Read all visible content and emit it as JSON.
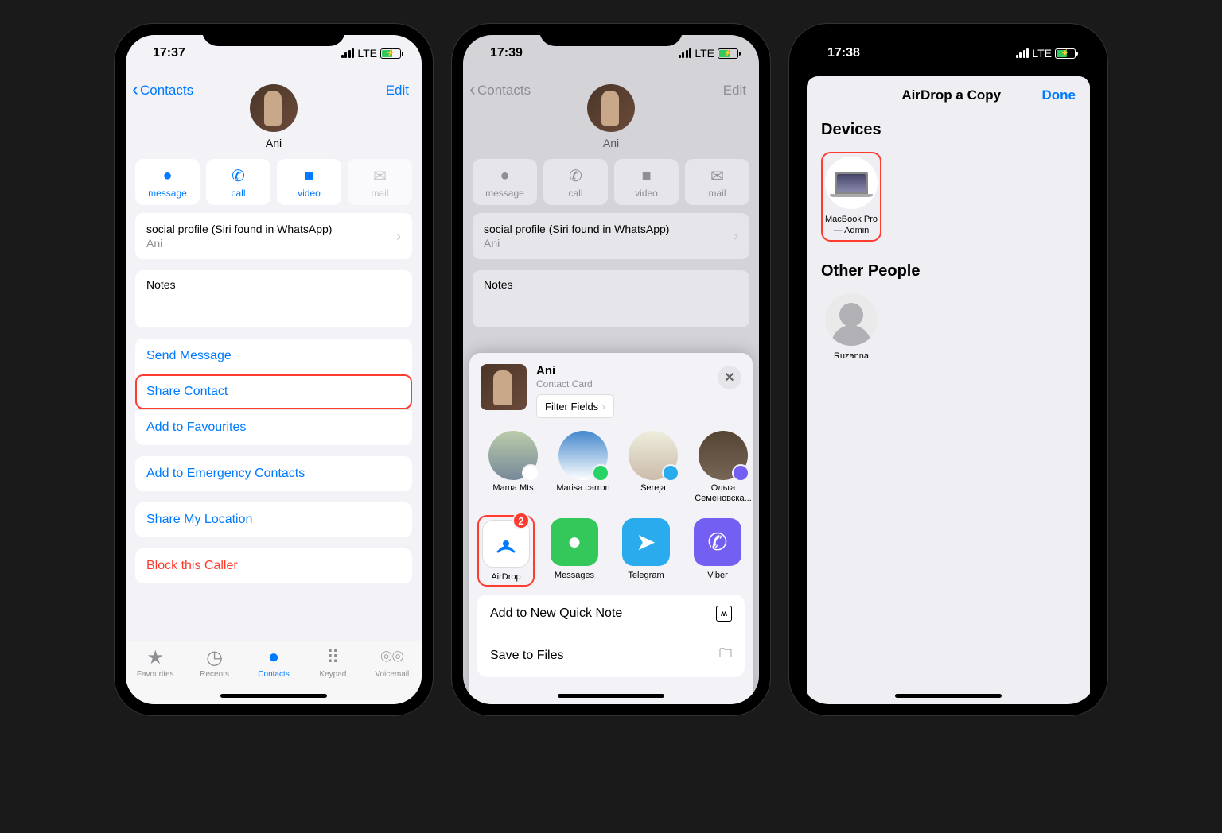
{
  "screens": [
    {
      "time": "17:37",
      "carrier": "LTE",
      "back": "Contacts",
      "edit": "Edit",
      "name": "Ani",
      "actions": [
        {
          "label": "message"
        },
        {
          "label": "call"
        },
        {
          "label": "video"
        },
        {
          "label": "mail",
          "disabled": true
        }
      ],
      "social": {
        "label": "social profile (Siri found in WhatsApp)",
        "value": "Ani"
      },
      "notes": "Notes",
      "rows": [
        "Send Message",
        "Share Contact",
        "Add to Favourites"
      ],
      "rows2": [
        "Add to Emergency Contacts"
      ],
      "rows3": [
        "Share My Location"
      ],
      "rows4": [
        "Block this Caller"
      ],
      "tabs": [
        {
          "label": "Favourites"
        },
        {
          "label": "Recents"
        },
        {
          "label": "Contacts",
          "active": true
        },
        {
          "label": "Keypad"
        },
        {
          "label": "Voicemail"
        }
      ]
    },
    {
      "time": "17:39",
      "carrier": "LTE",
      "back": "Contacts",
      "edit": "Edit",
      "name": "Ani",
      "actions": [
        {
          "label": "message"
        },
        {
          "label": "call"
        },
        {
          "label": "video"
        },
        {
          "label": "mail"
        }
      ],
      "social": {
        "label": "social profile (Siri found in WhatsApp)",
        "value": "Ani"
      },
      "notes": "Notes",
      "share": {
        "title": "Ani",
        "subtitle": "Contact Card",
        "filter": "Filter Fields",
        "people": [
          {
            "name": "Mama Mts",
            "badge": "airdrop"
          },
          {
            "name": "Marisa carron",
            "badge": "whatsapp"
          },
          {
            "name": "Sereja",
            "badge": "telegram"
          },
          {
            "name": "Ольга Семеновска...",
            "badge": "viber"
          }
        ],
        "apps": [
          {
            "name": "AirDrop",
            "color": "white",
            "badge": 2,
            "highlight": true
          },
          {
            "name": "Messages",
            "color": "green"
          },
          {
            "name": "Telegram",
            "color": "blue"
          },
          {
            "name": "Viber",
            "color": "purple"
          }
        ],
        "sheet_rows": [
          "Add to New Quick Note",
          "Save to Files"
        ]
      }
    },
    {
      "time": "17:38",
      "carrier": "LTE",
      "title": "AirDrop a Copy",
      "done": "Done",
      "devices_title": "Devices",
      "devices": [
        {
          "name": "MacBook Pro — Admin",
          "highlight": true
        }
      ],
      "people_title": "Other People",
      "people": [
        {
          "name": "Ruzanna"
        }
      ]
    }
  ]
}
